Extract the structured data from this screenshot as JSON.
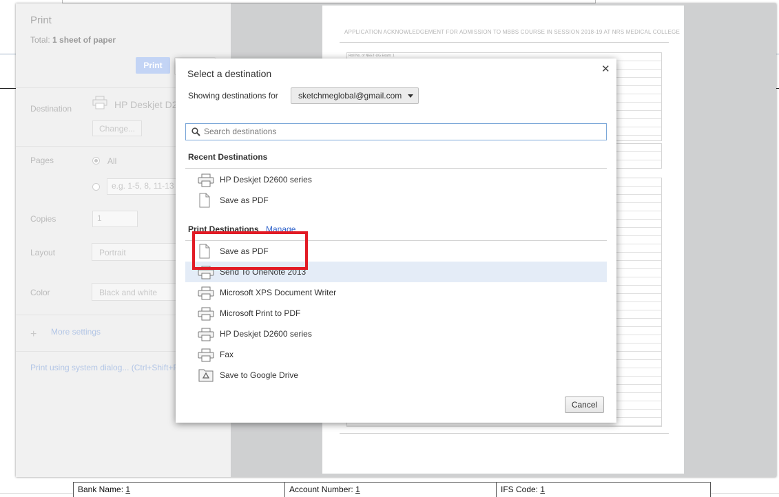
{
  "print_panel": {
    "title": "Print",
    "total_prefix": "Total:",
    "total_value": "1 sheet of paper",
    "print_button": "Print",
    "destination_label": "Destination",
    "destination_value": "HP Deskjet D26",
    "change_button": "Change...",
    "pages_label": "Pages",
    "pages_all": "All",
    "pages_custom_placeholder": "e.g. 1-5, 8, 11-13",
    "copies_label": "Copies",
    "copies_value": "1",
    "layout_label": "Layout",
    "layout_value": "Portrait",
    "color_label": "Color",
    "color_value": "Black and white",
    "more_settings": "More settings",
    "system_dialog_link": "Print using system dialog... (Ctrl+Shift+P)"
  },
  "preview": {
    "header": "APPLICATION ACKNOWLEDGEMENT FOR ADMISSION TO MBBS COURSE IN SESSION 2018-19 AT NRS MEDICAL COLLEGE",
    "form_first_row": "Roll No. of NEET-UG Exam: 1"
  },
  "background_page": {
    "bank_name": "Bank Name:",
    "bank_name_value": "1",
    "account_number": "Account Number:",
    "account_number_value": "1",
    "ifs_code": "IFS Code:",
    "ifs_code_value": "1"
  },
  "dialog": {
    "title": "Select a destination",
    "showing_label": "Showing destinations for",
    "account": "sketchmeglobal@gmail.com",
    "search_placeholder": "Search destinations",
    "recent_heading": "Recent Destinations",
    "recent": [
      {
        "label": "HP Deskjet D2600 series",
        "icon": "printer-icon"
      },
      {
        "label": "Save as PDF",
        "icon": "document-icon"
      }
    ],
    "print_heading": "Print Destinations",
    "manage_link": "Manage",
    "destinations": [
      {
        "label": "Save as PDF",
        "icon": "document-icon"
      },
      {
        "label": "Send To OneNote 2013",
        "icon": "printer-icon"
      },
      {
        "label": "Microsoft XPS Document Writer",
        "icon": "printer-icon"
      },
      {
        "label": "Microsoft Print to PDF",
        "icon": "printer-icon"
      },
      {
        "label": "HP Deskjet D2600 series",
        "icon": "printer-icon"
      },
      {
        "label": "Fax",
        "icon": "printer-icon"
      },
      {
        "label": "Save to Google Drive",
        "icon": "google-drive-icon"
      }
    ],
    "cancel_button": "Cancel"
  },
  "colors": {
    "highlight": "#e21b25",
    "hover_row": "#e4ecf7",
    "link": "#3366cc"
  }
}
